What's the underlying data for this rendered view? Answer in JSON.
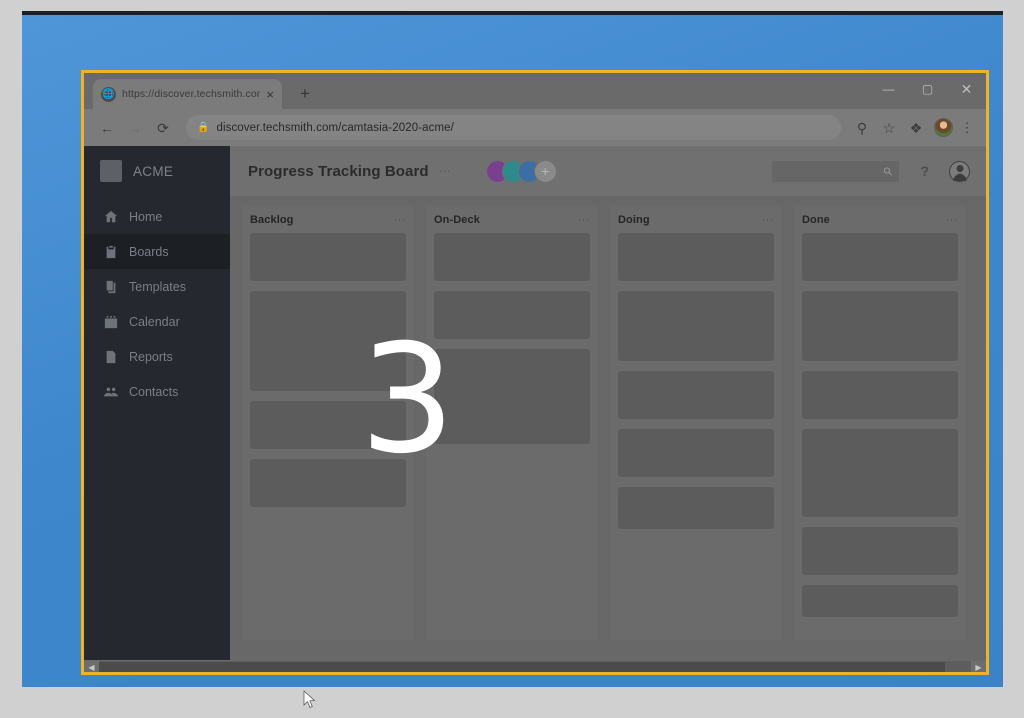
{
  "browser": {
    "tab": {
      "title": "https://discover.techsmith.com/c",
      "favicon_icon": "globe-icon",
      "close_icon": "×"
    },
    "new_tab_label": "+",
    "window_controls": {
      "minimize": "—",
      "maximize": "▢",
      "close": "✕"
    },
    "nav": {
      "back": "←",
      "forward": "→",
      "reload": "⟳"
    },
    "address": {
      "lock_icon": "🔒",
      "url": "discover.techsmith.com/camtasia-2020-acme/"
    },
    "actions": {
      "zoom_icon": "⌕",
      "bookmark_icon": "☆",
      "extensions_icon": "✦",
      "profile_icon": "avatar-photo",
      "menu_icon": "⋮"
    }
  },
  "sidebar": {
    "brand": "ACME",
    "items": [
      {
        "label": "Home",
        "icon": "home-icon",
        "active": false
      },
      {
        "label": "Boards",
        "icon": "clipboard-icon",
        "active": true
      },
      {
        "label": "Templates",
        "icon": "copy-icon",
        "active": false
      },
      {
        "label": "Calendar",
        "icon": "calendar-icon",
        "active": false
      },
      {
        "label": "Reports",
        "icon": "document-icon",
        "active": false
      },
      {
        "label": "Contacts",
        "icon": "people-icon",
        "active": false
      }
    ]
  },
  "app_header": {
    "board_title": "Progress Tracking Board",
    "title_menu_icon": "⋯",
    "avatars": [
      {
        "name": "member-1",
        "color": "#7b3f8f"
      },
      {
        "name": "member-2",
        "color": "#2d8b8b"
      },
      {
        "name": "member-3",
        "color": "#3a6ea5"
      }
    ],
    "add_member_label": "+",
    "search_placeholder": "",
    "search_value": "",
    "search_icon": "⌕",
    "help_label": "?"
  },
  "board": {
    "columns": [
      {
        "title": "Backlog",
        "menu_icon": "⋯",
        "cards": [
          48,
          100,
          48,
          48
        ]
      },
      {
        "title": "On-Deck",
        "menu_icon": "⋯",
        "cards": [
          48,
          48,
          95
        ]
      },
      {
        "title": "Doing",
        "menu_icon": "⋯",
        "cards": [
          48,
          70,
          48,
          48,
          42
        ]
      },
      {
        "title": "Done",
        "menu_icon": "⋯",
        "cards": [
          48,
          70,
          48,
          88,
          48,
          32
        ]
      }
    ]
  },
  "countdown": {
    "value": "3"
  },
  "scrollbar": {
    "left_arrow": "◀",
    "right_arrow": "▶"
  },
  "colors": {
    "accent_border": "#f0b323",
    "sidebar_bg": "#25282e",
    "board_bg": "#686868",
    "column_bg": "#6b6b6b",
    "card_bg": "#5c5c5c",
    "desktop_blue": "#3f87cd"
  }
}
